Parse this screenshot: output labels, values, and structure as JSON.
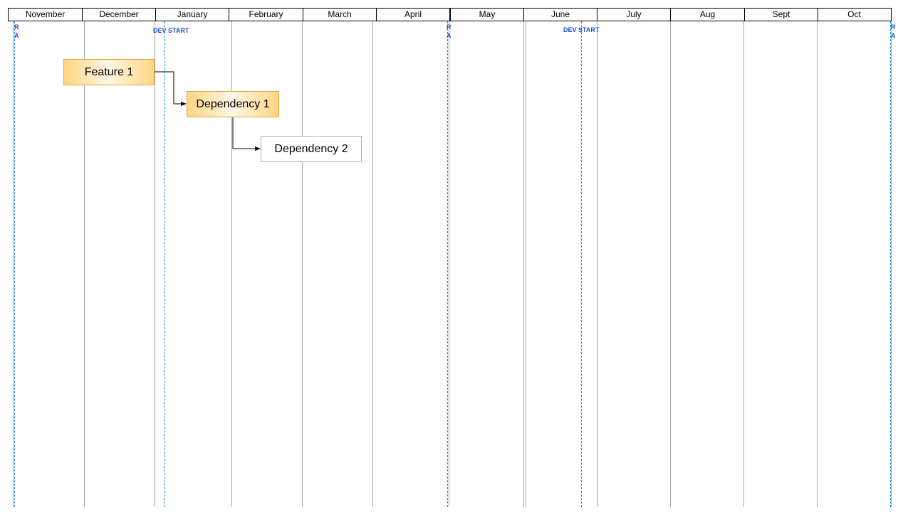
{
  "timeline": {
    "months": [
      "November",
      "December",
      "January",
      "February",
      "March",
      "April",
      "May",
      "June",
      "July",
      "Aug",
      "Sept",
      "Oct"
    ]
  },
  "markers": [
    {
      "label": "R\nA",
      "kind": "release"
    },
    {
      "label": "DEV START",
      "kind": "dev-start"
    },
    {
      "label": "R\nA",
      "kind": "release"
    },
    {
      "label": "DEV START",
      "kind": "dev-start"
    },
    {
      "label": "R\nA",
      "kind": "release"
    }
  ],
  "tasks": [
    {
      "label": "Feature 1",
      "style": "gold"
    },
    {
      "label": "Dependency 1",
      "style": "gold"
    },
    {
      "label": "Dependency 2",
      "style": "plain"
    }
  ],
  "dependencies": [
    {
      "from": "Feature 1",
      "to": "Dependency 1"
    },
    {
      "from": "Dependency 1",
      "to": "Dependency 2"
    }
  ],
  "colors": {
    "marker": "#1a8fd6",
    "marker_label": "#1a4fd6",
    "task_fill": "#ffd680",
    "task_border": "#d6a646"
  }
}
